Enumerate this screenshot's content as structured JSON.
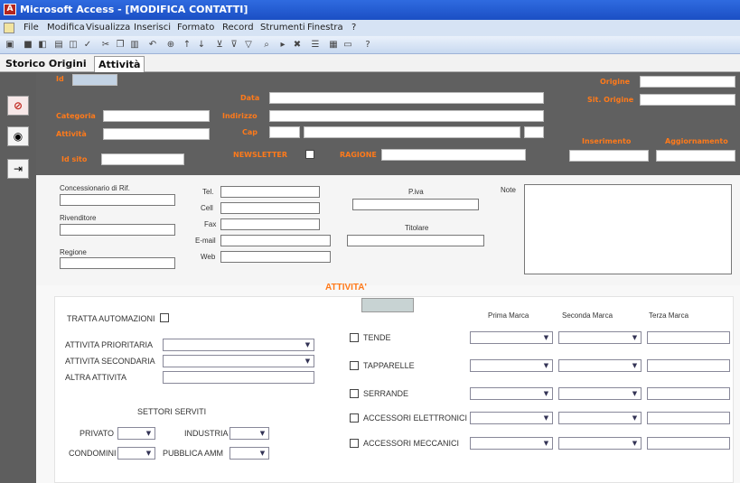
{
  "window": {
    "title": "Microsoft Access - [MODIFICA CONTATTI]"
  },
  "menu": [
    "File",
    "Modifica",
    "Visualizza",
    "Inserisci",
    "Formato",
    "Record",
    "Strumenti",
    "Finestra",
    "?"
  ],
  "tabs": [
    "Storico Origini",
    "Attività"
  ],
  "header": {
    "id": "Id",
    "categoria": "Categoria",
    "attivita": "Attività",
    "id_site": "Id sito",
    "data": "Data",
    "indirizzo": "Indirizzo",
    "cap": "Cap",
    "newsletter": "NEWSLETTER",
    "ragione": "RAGIONE",
    "origine": "Origine",
    "sit_origine": "Sit. Origine",
    "inserimento": "Inserimento",
    "aggiornamento": "Aggiornamento"
  },
  "details": {
    "concessionario": "Concessionario di Rif.",
    "rivenditore": "Rivenditore",
    "regione": "Regione",
    "tel": "Tel.",
    "cell": "Cell",
    "fax": "Fax",
    "email": "E-mail",
    "web": "Web",
    "piva": "P.iva",
    "titolare": "Titolare",
    "note": "Note"
  },
  "activity": {
    "title": "ATTIVITA'",
    "tratta": "TRATTA AUTOMAZIONI",
    "prioritaria": "ATTIVITA PRIORITARIA",
    "secondaria": "ATTIVITA SECONDARIA",
    "altra": "ALTRA ATTIVITA",
    "settori": "SETTORI SERVITI",
    "privato": "PRIVATO",
    "industria": "INDUSTRIA",
    "condomini": "CONDOMINI",
    "pubblica": "PUBBLICA AMM",
    "prima": "Prima Marca",
    "seconda": "Seconda Marca",
    "terza": "Terza Marca",
    "products": [
      "TENDE",
      "TAPPARELLE",
      "SERRANDE",
      "ACCESSORI ELETTRONICI",
      "ACCESSORI MECCANICI"
    ]
  }
}
